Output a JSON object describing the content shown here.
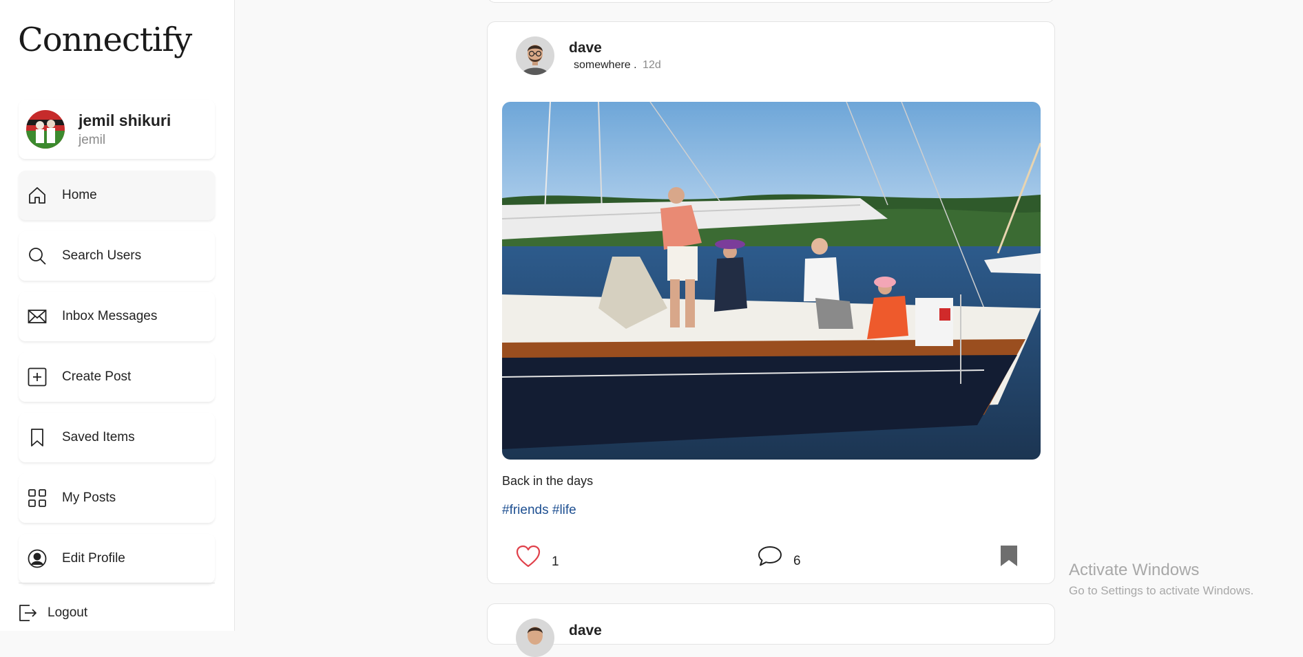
{
  "app": {
    "logo": "Connectify"
  },
  "profile": {
    "name": "jemil shikuri",
    "handle": "jemil"
  },
  "nav": {
    "items": [
      {
        "label": "Home",
        "icon": "home-icon"
      },
      {
        "label": "Search Users",
        "icon": "search-icon"
      },
      {
        "label": "Inbox Messages",
        "icon": "mail-icon"
      },
      {
        "label": "Create Post",
        "icon": "plus-square-icon"
      },
      {
        "label": "Saved Items",
        "icon": "bookmark-icon"
      },
      {
        "label": "My Posts",
        "icon": "grid-icon"
      },
      {
        "label": "Edit Profile",
        "icon": "user-circle-icon"
      }
    ],
    "logout": "Logout"
  },
  "post": {
    "user": "dave",
    "location": "somewhere .",
    "time": "12d",
    "caption": "Back in the days",
    "tags": "#friends #life",
    "likes": "1",
    "comments": "6",
    "like_color": "#e0404a"
  },
  "next_post": {
    "user": "dave"
  },
  "watermark": {
    "title": "Activate Windows",
    "subtitle": "Go to Settings to activate Windows."
  }
}
